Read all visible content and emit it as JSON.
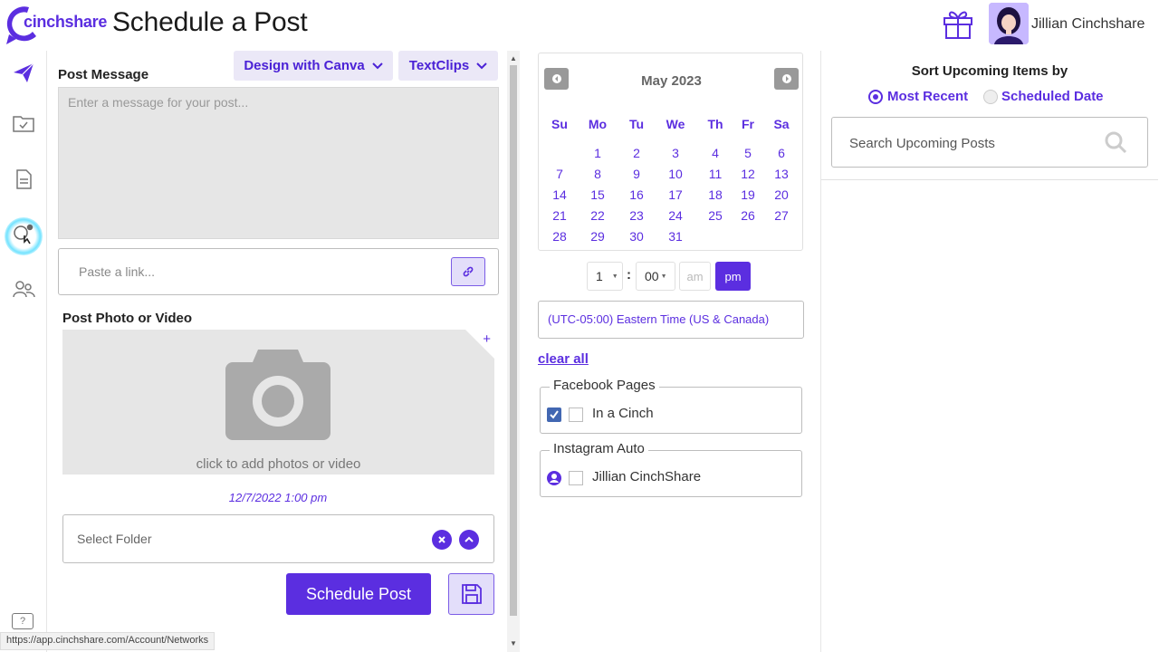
{
  "header": {
    "logo_text": "cinchshare",
    "page_title": "Schedule a Post",
    "user_name": "Jillian Cinchshare"
  },
  "nav": {
    "icons": [
      "send-icon",
      "folder-check-icon",
      "document-icon",
      "networks-icon",
      "users-icon",
      "help-icon"
    ],
    "help_label": "?"
  },
  "compose": {
    "post_message_label": "Post Message",
    "design_canva_label": "Design with Canva",
    "textclips_label": "TextClips",
    "message_placeholder": "Enter a message for your post...",
    "link_placeholder": "Paste a link...",
    "photo_label": "Post Photo or Video",
    "photo_caption": "click to add photos or video",
    "photo_plus": "+",
    "date_stamp": "12/7/2022 1:00 pm",
    "folder_placeholder": "Select Folder",
    "schedule_label": "Schedule Post"
  },
  "calendar": {
    "month_title": "May 2023",
    "days_of_week": [
      "Su",
      "Mo",
      "Tu",
      "We",
      "Th",
      "Fr",
      "Sa"
    ],
    "weeks": [
      [
        "",
        "1",
        "2",
        "3",
        "4",
        "5",
        "6"
      ],
      [
        "7",
        "8",
        "9",
        "10",
        "11",
        "12",
        "13"
      ],
      [
        "14",
        "15",
        "16",
        "17",
        "18",
        "19",
        "20"
      ],
      [
        "21",
        "22",
        "23",
        "24",
        "25",
        "26",
        "27"
      ],
      [
        "28",
        "29",
        "30",
        "31",
        "",
        "",
        ""
      ]
    ]
  },
  "time": {
    "hour": "1",
    "separator": ":",
    "minute": "00",
    "am_label": "am",
    "pm_label": "pm",
    "selected": "pm"
  },
  "timezone": {
    "value": "(UTC-05:00) Eastern Time (US & Canada)"
  },
  "networks": {
    "clear_all_label": "clear all",
    "groups": [
      {
        "legend": "Facebook Pages",
        "account": "In a Cinch",
        "icon": "facebook-icon"
      },
      {
        "legend": "Instagram Auto",
        "account": "Jillian CinchShare",
        "icon": "instagram-icon"
      }
    ]
  },
  "upcoming": {
    "sort_title": "Sort Upcoming Items by",
    "option_recent": "Most Recent",
    "option_scheduled": "Scheduled Date",
    "selected": "Most Recent",
    "search_placeholder": "Search Upcoming Posts"
  },
  "status_bar": {
    "url": "https://app.cinchshare.com/Account/Networks"
  },
  "colors": {
    "brand": "#5b2ee0",
    "chip_bg": "#ebe8f7",
    "input_bg": "#e6e6e6"
  }
}
